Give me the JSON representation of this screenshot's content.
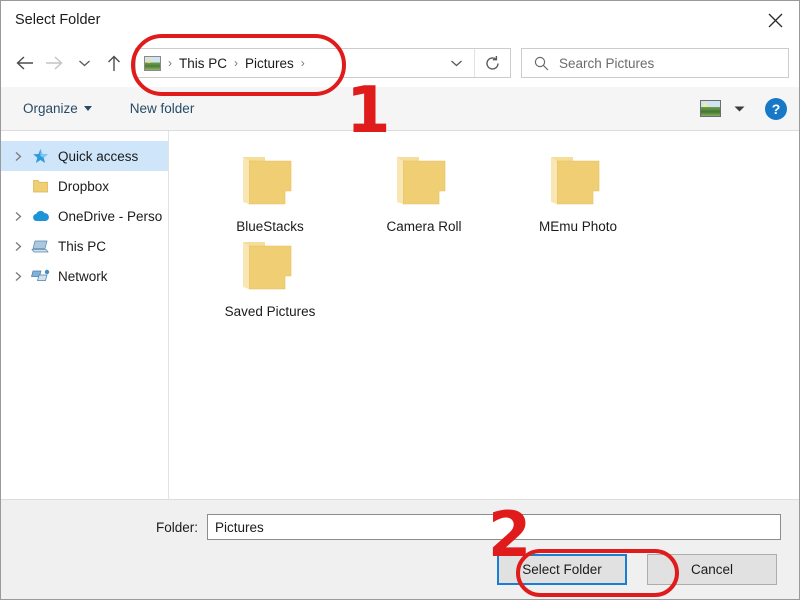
{
  "window": {
    "title": "Select Folder",
    "close_icon": "close-icon"
  },
  "nav": {
    "back_icon": "arrow-left-icon",
    "forward_icon": "arrow-right-icon",
    "recent_icon": "chevron-down-icon",
    "up_icon": "arrow-up-icon",
    "breadcrumb_icon": "pictures-folder-icon",
    "breadcrumb": [
      "This PC",
      "Pictures"
    ],
    "separator": "›",
    "history_icon": "chevron-down-icon",
    "refresh_icon": "refresh-icon"
  },
  "search": {
    "icon": "search-icon",
    "placeholder": "Search Pictures",
    "value": ""
  },
  "toolbar": {
    "organize_label": "Organize",
    "new_folder_label": "New folder",
    "view_icon": "view-layout-icon",
    "view_caret_icon": "chevron-down-icon",
    "help_label": "?",
    "help_icon": "help-icon"
  },
  "sidebar": {
    "items": [
      {
        "label": "Quick access",
        "icon": "star-icon",
        "expandable": true,
        "selected": true
      },
      {
        "label": "Dropbox",
        "icon": "folder-icon",
        "expandable": false,
        "selected": false
      },
      {
        "label": "OneDrive - Perso",
        "icon": "cloud-icon",
        "expandable": true,
        "selected": false
      },
      {
        "label": "This PC",
        "icon": "computer-icon",
        "expandable": true,
        "selected": false
      },
      {
        "label": "Network",
        "icon": "network-icon",
        "expandable": true,
        "selected": false
      }
    ]
  },
  "content": {
    "files": [
      {
        "name": "BlueStacks",
        "icon": "folder-icon"
      },
      {
        "name": "Camera Roll",
        "icon": "folder-icon"
      },
      {
        "name": "MEmu Photo",
        "icon": "folder-icon"
      },
      {
        "name": "Saved Pictures",
        "icon": "folder-icon"
      }
    ]
  },
  "footer": {
    "folder_label": "Folder:",
    "folder_value": "Pictures",
    "select_button": "Select Folder",
    "cancel_button": "Cancel"
  },
  "annotations": {
    "marker_one": "1",
    "marker_two": "2",
    "color": "#e01b1b"
  },
  "colors": {
    "accent_blue": "#1878c8",
    "selection_blue": "#cfe5fa",
    "folder_yellow": "#f0ce74",
    "annotation_red": "#e01b1b",
    "toolbar_link": "#274b66"
  }
}
